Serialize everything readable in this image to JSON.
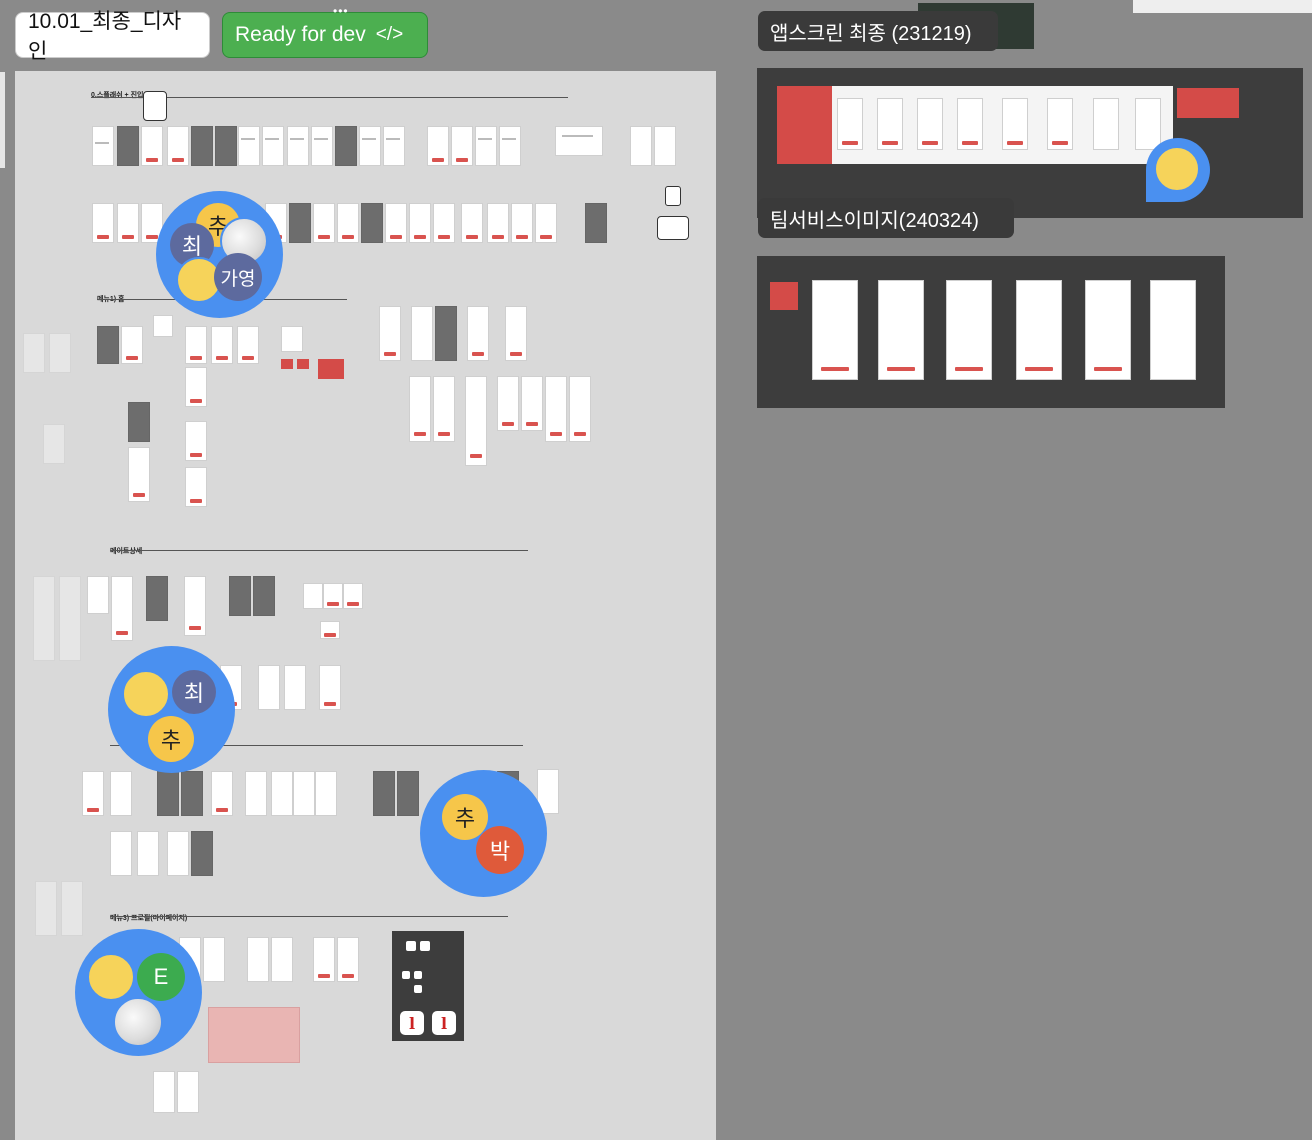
{
  "header": {
    "page_title": "10.01_최종_디자인",
    "status_label": "Ready for dev",
    "status_icon": "code-icon",
    "colors": {
      "status_green": "#4caf50",
      "canvas_bg": "#8a8a8a",
      "brand_red": "#d44b48"
    }
  },
  "canvas": {
    "sections": [
      {
        "label": "0.스플래쉬 + 진입"
      },
      {
        "label": "메뉴1) 홈"
      },
      {
        "label": "메이트상세"
      },
      {
        "label": "메뉴3) 프로필(마이페이지)"
      }
    ],
    "frames": [
      {
        "label": "앱스크린 최종 (231219)"
      },
      {
        "label": "팀서비스이미지(240324)"
      }
    ],
    "cursors": [
      {
        "avatars": [
          "추",
          "최",
          "가영"
        ]
      },
      {
        "avatars": [
          "최",
          "추"
        ]
      },
      {
        "avatars": [
          "추",
          "박"
        ]
      },
      {
        "avatars": [
          "E"
        ]
      }
    ]
  }
}
